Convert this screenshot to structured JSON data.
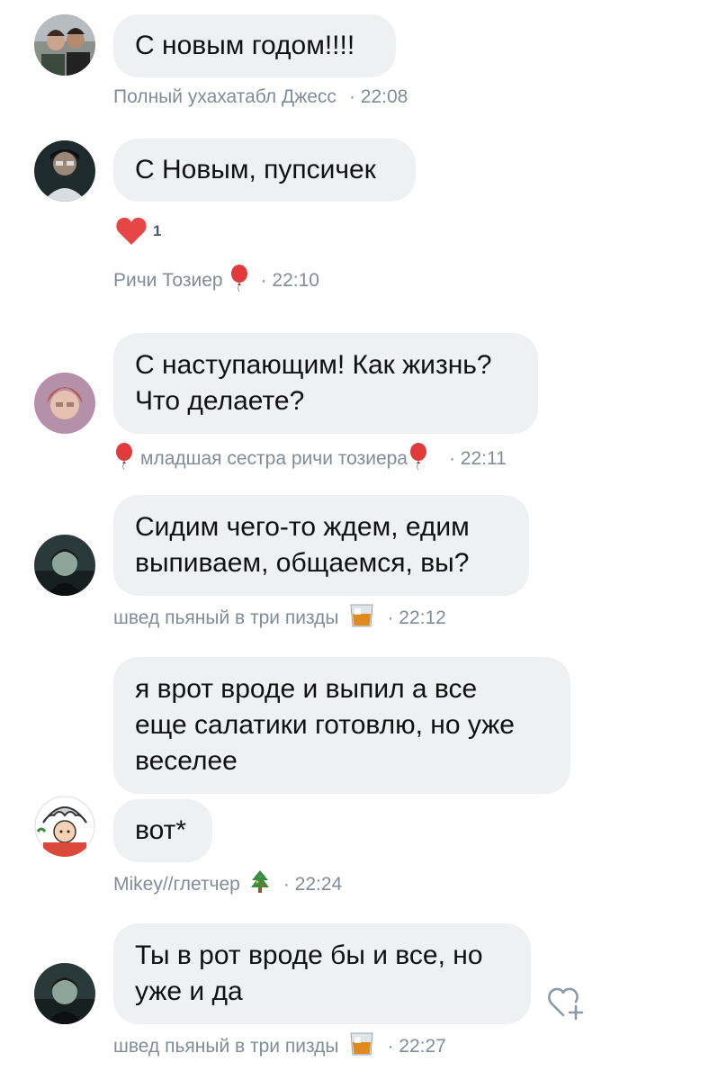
{
  "messages": [
    {
      "author": "Полный ухахатабл Джесс",
      "text": "С новым годом!!!!",
      "time": "· 22:08"
    },
    {
      "author": "Ричи Тозиер",
      "text": "С Новым, пупсичек",
      "time": "· 22:10",
      "likes": "1"
    },
    {
      "author_prefix_icon": "balloon",
      "author": "младшая сестра ричи тозиера",
      "text": "С наступающим! Как жизнь?\nЧто делаете?",
      "time": "· 22:11"
    },
    {
      "author": "швед пьяный в три пизды",
      "text": "Сидим чего-то ждем, едим\nвыпиваем, общаемся, вы?",
      "time": "· 22:12"
    },
    {
      "author": "Mikey//глетчер",
      "text": "я врот вроде и выпил а все\nеще салатики готовлю, но уже\nвеселее",
      "text2": "вот*",
      "time": "· 22:24"
    },
    {
      "author": "швед пьяный в три пизды",
      "text": "Ты в рот вроде бы и все, но\nуже и да",
      "time": "· 22:27"
    }
  ],
  "icons": {
    "author_emoji_richie": "balloon",
    "author_emoji_shved": "whisky-glass",
    "author_emoji_mikey": "christmas-tree",
    "like_icon": "heart",
    "add_reaction_icon": "heart-plus"
  },
  "colors": {
    "bubble": "#eff0f2",
    "meta": "#818c99",
    "heart": "#e64646"
  }
}
